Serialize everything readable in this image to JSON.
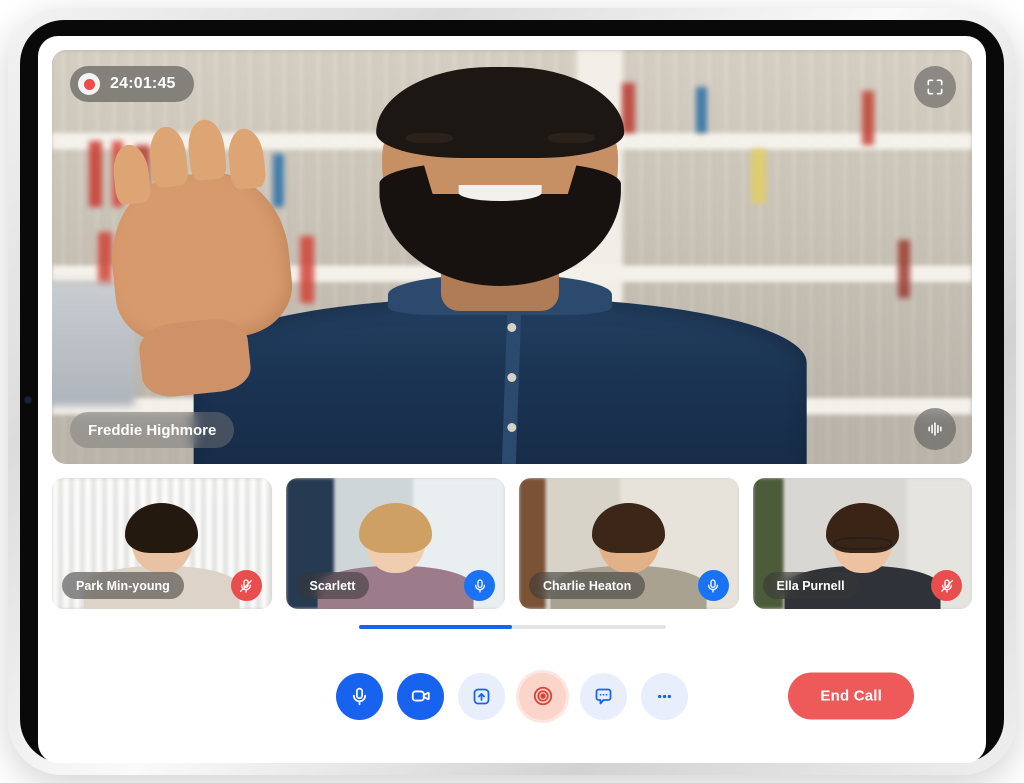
{
  "app": {
    "title": "Video Call",
    "device": "tablet"
  },
  "main_video": {
    "speaker_name": "Freddie Highmore",
    "recording": {
      "label": "24:01:45",
      "dot_color": "#ee4b4b",
      "indicator_icon": "record-dot-icon"
    },
    "expand_icon": "fullscreen-icon",
    "audio_icon": "audio-waveform-icon",
    "scene_description": "Man waving in front of a bookshelf"
  },
  "participants": [
    {
      "name": "Park Min-young",
      "mic_state": "muted",
      "mic_icon": "microphone-muted-icon",
      "badge_color": "#ea4d4d"
    },
    {
      "name": "Scarlett",
      "mic_state": "active",
      "mic_icon": "microphone-icon",
      "badge_color": "#1a73f5"
    },
    {
      "name": "Charlie Heaton",
      "mic_state": "active",
      "mic_icon": "microphone-icon",
      "badge_color": "#1a73f5"
    },
    {
      "name": "Ella Purnell",
      "mic_state": "muted",
      "mic_icon": "microphone-muted-icon",
      "badge_color": "#ea4d4d"
    }
  ],
  "scroll": {
    "progress_percent": 50,
    "track_color": "#e3e4e6",
    "thumb_color": "#1763f0"
  },
  "controls": {
    "buttons": [
      {
        "name": "microphone",
        "icon": "microphone-icon",
        "style": "primary",
        "label": "Mute"
      },
      {
        "name": "camera",
        "icon": "video-camera-icon",
        "style": "primary",
        "label": "Stop Video"
      },
      {
        "name": "share-screen",
        "icon": "share-screen-icon",
        "style": "soft",
        "label": "Share Screen"
      },
      {
        "name": "record",
        "icon": "record-icon",
        "style": "record",
        "label": "Record"
      },
      {
        "name": "chat",
        "icon": "chat-bubble-icon",
        "style": "soft",
        "label": "Chat"
      },
      {
        "name": "more",
        "icon": "more-options-icon",
        "style": "soft",
        "label": "More"
      }
    ],
    "end_call_label": "End Call",
    "end_call_color": "#ee5a5a",
    "accent_color": "#1763f0"
  }
}
